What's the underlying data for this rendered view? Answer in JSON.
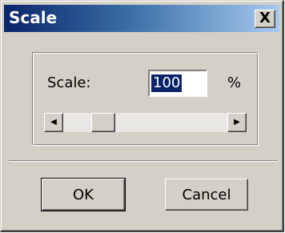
{
  "dialog": {
    "title": "Scale",
    "close_label": "X"
  },
  "scale_field": {
    "label": "Scale:",
    "value": "100",
    "unit": "%"
  },
  "slider": {
    "left_arrow": "◀",
    "right_arrow": "▶",
    "position_fraction": 0.2
  },
  "buttons": {
    "ok_label": "OK",
    "cancel_label": "Cancel"
  },
  "colors": {
    "titlebar_start": "#0a246a",
    "titlebar_end": "#a6caf0",
    "face": "#d4d0c8",
    "selection": "#0a246a"
  }
}
